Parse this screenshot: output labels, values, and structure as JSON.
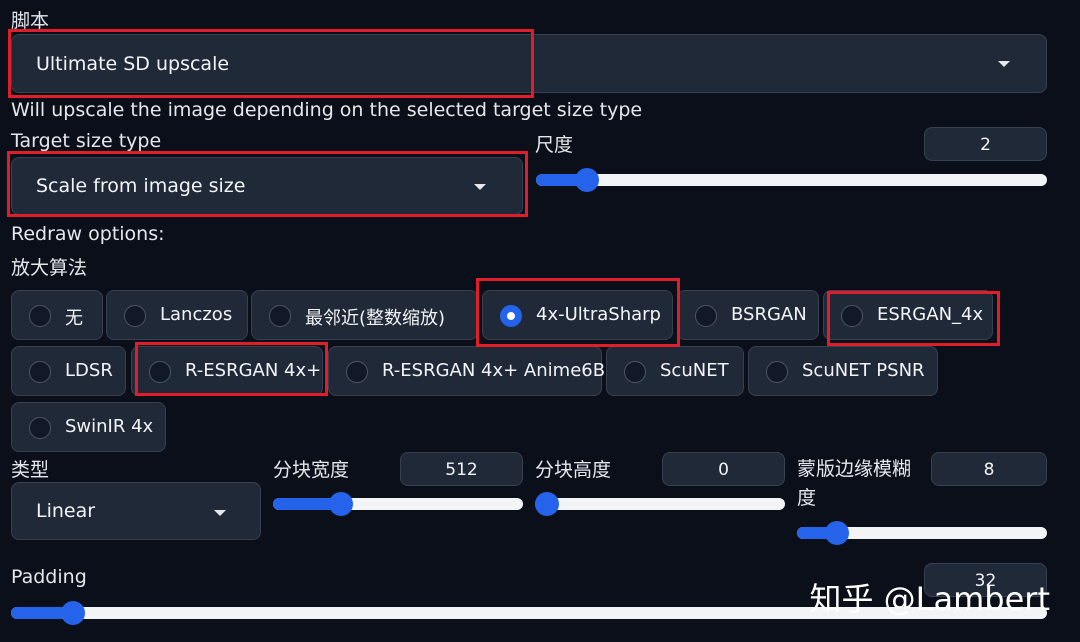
{
  "script": {
    "label": "脚本",
    "value": "Ultimate SD upscale"
  },
  "description": "Will upscale the image depending on the selected target size type",
  "target_size": {
    "label": "Target size type",
    "value": "Scale from image size"
  },
  "scale": {
    "label": "尺度",
    "value": "2",
    "level": 0.1
  },
  "redraw_label": "Redraw options:",
  "upscaler": {
    "label": "放大算法",
    "options": [
      "无",
      "Lanczos",
      "最邻近(整数缩放)",
      "4x-UltraSharp",
      "BSRGAN",
      "ESRGAN_4x",
      "LDSR",
      "R-ESRGAN 4x+",
      "R-ESRGAN 4x+ Anime6B",
      "ScuNET",
      "ScuNET PSNR",
      "SwinIR 4x"
    ],
    "selected": "4x-UltraSharp"
  },
  "type": {
    "label": "类型",
    "value": "Linear"
  },
  "tile_width": {
    "label": "分块宽度",
    "value": "512",
    "level": 0.27
  },
  "tile_height": {
    "label": "分块高度",
    "value": "0",
    "level": 0.0
  },
  "mask_blur": {
    "label": "蒙版边缘模糊度",
    "value": "8",
    "level": 0.16
  },
  "padding": {
    "label": "Padding",
    "value": "32",
    "level": 0.06
  },
  "watermark": "知乎 @Lambert",
  "colors": {
    "accent": "#2563eb",
    "highlight": "#e11d2a",
    "background": "#0b0f19",
    "panel": "#1f2937"
  }
}
